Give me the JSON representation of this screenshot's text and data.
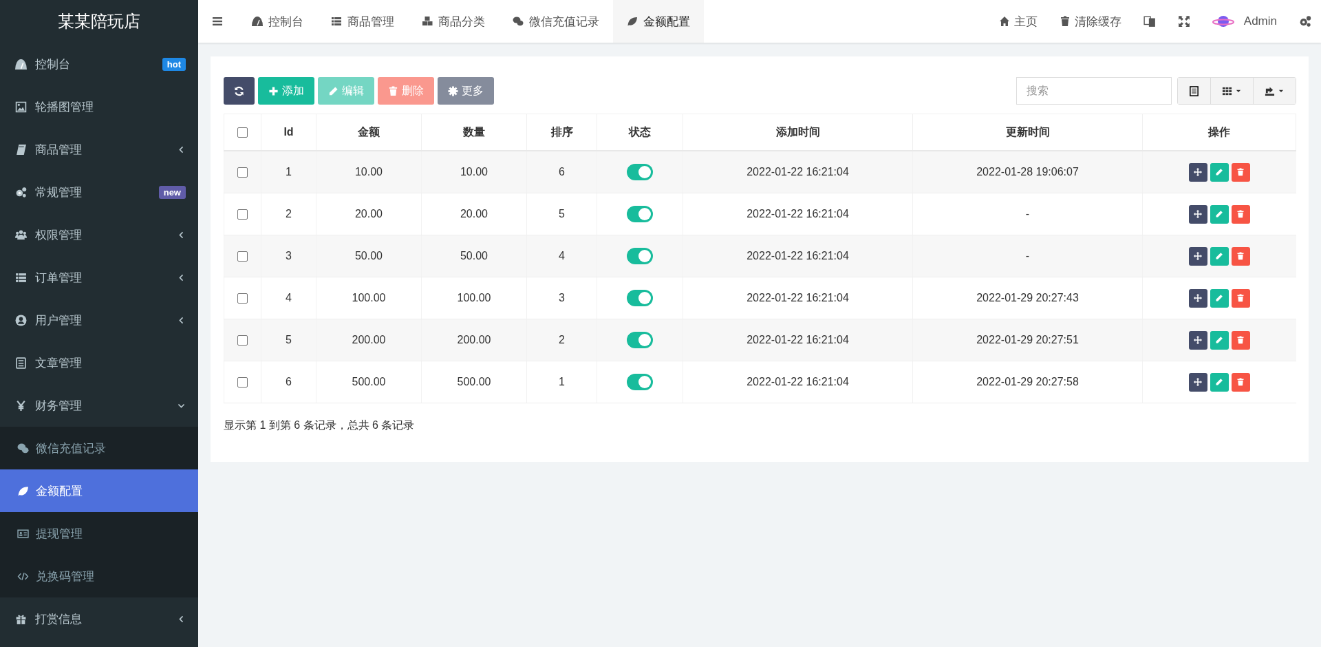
{
  "brand": "某某陪玩店",
  "sidebar": {
    "items": [
      {
        "label": "控制台",
        "kind": "link",
        "selected": false,
        "badge": {
          "text": "hot",
          "color": "#1e88e5"
        }
      },
      {
        "label": "轮播图管理",
        "kind": "link",
        "selected": false
      },
      {
        "label": "商品管理",
        "kind": "group",
        "selected": false,
        "expanded": false
      },
      {
        "label": "常规管理",
        "kind": "link",
        "selected": false,
        "badge": {
          "text": "new",
          "color": "#605ca8"
        }
      },
      {
        "label": "权限管理",
        "kind": "group",
        "selected": false,
        "expanded": false
      },
      {
        "label": "订单管理",
        "kind": "group",
        "selected": false,
        "expanded": false
      },
      {
        "label": "用户管理",
        "kind": "group",
        "selected": false,
        "expanded": false
      },
      {
        "label": "文章管理",
        "kind": "link",
        "selected": false
      },
      {
        "label": "财务管理",
        "kind": "group",
        "selected": false,
        "expanded": true,
        "children": [
          {
            "label": "微信充值记录",
            "selected": false
          },
          {
            "label": "金额配置",
            "selected": true
          },
          {
            "label": "提现管理",
            "selected": false
          },
          {
            "label": "兑换码管理",
            "selected": false
          }
        ]
      },
      {
        "label": "打赏信息",
        "kind": "group",
        "selected": false,
        "expanded": false
      }
    ]
  },
  "nav_tabs": [
    {
      "label": "控制台",
      "selected": false
    },
    {
      "label": "商品管理",
      "selected": false
    },
    {
      "label": "商品分类",
      "selected": false
    },
    {
      "label": "微信充值记录",
      "selected": false
    },
    {
      "label": "金额配置",
      "selected": true
    }
  ],
  "top_links": [
    {
      "label": "主页"
    },
    {
      "label": "清除缓存"
    }
  ],
  "user": {
    "name": "Admin"
  },
  "toolbar": [
    {
      "kind": "refresh",
      "disabled": false
    },
    {
      "kind": "add",
      "label": "添加",
      "disabled": false
    },
    {
      "kind": "edit",
      "label": "编辑",
      "disabled": true
    },
    {
      "kind": "delete",
      "label": "删除",
      "disabled": true
    },
    {
      "kind": "more",
      "label": "更多",
      "disabled": false
    }
  ],
  "search": {
    "placeholder": "搜索"
  },
  "table": {
    "all_checked": false,
    "columns": [
      "Id",
      "金额",
      "数量",
      "排序",
      "状态",
      "添加时间",
      "更新时间",
      "操作"
    ],
    "rows": [
      {
        "checked": false,
        "id": "1",
        "amount": "10.00",
        "quantity": "10.00",
        "sort": "6",
        "status_on": true,
        "added": "2022-01-22 16:21:04",
        "updated": "2022-01-28 19:06:07"
      },
      {
        "checked": false,
        "id": "2",
        "amount": "20.00",
        "quantity": "20.00",
        "sort": "5",
        "status_on": true,
        "added": "2022-01-22 16:21:04",
        "updated": "-"
      },
      {
        "checked": false,
        "id": "3",
        "amount": "50.00",
        "quantity": "50.00",
        "sort": "4",
        "status_on": true,
        "added": "2022-01-22 16:21:04",
        "updated": "-"
      },
      {
        "checked": false,
        "id": "4",
        "amount": "100.00",
        "quantity": "100.00",
        "sort": "3",
        "status_on": true,
        "added": "2022-01-22 16:21:04",
        "updated": "2022-01-29 20:27:43"
      },
      {
        "checked": false,
        "id": "5",
        "amount": "200.00",
        "quantity": "200.00",
        "sort": "2",
        "status_on": true,
        "added": "2022-01-22 16:21:04",
        "updated": "2022-01-29 20:27:51"
      },
      {
        "checked": false,
        "id": "6",
        "amount": "500.00",
        "quantity": "500.00",
        "sort": "1",
        "status_on": true,
        "added": "2022-01-22 16:21:04",
        "updated": "2022-01-29 20:27:58"
      }
    ]
  },
  "pagination_info": "显示第 1 到第 6 条记录，总共 6 条记录"
}
